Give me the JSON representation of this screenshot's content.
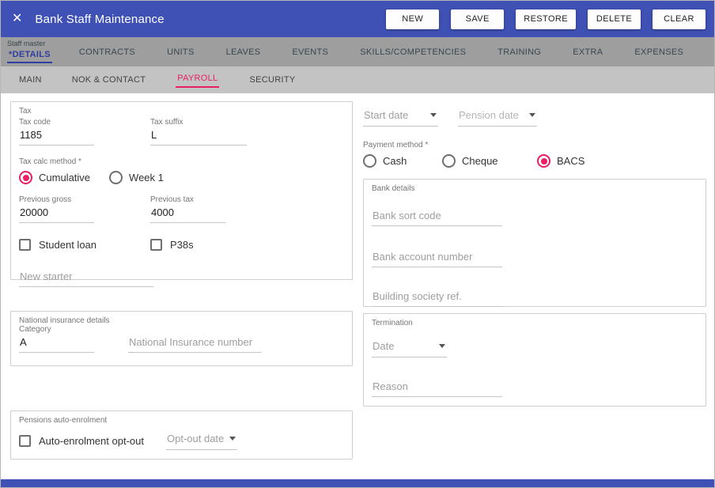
{
  "colors": {
    "header_bg": "#3f51b5",
    "accent_pink": "#e91e63",
    "active_tab_blue": "#303f9f"
  },
  "header": {
    "title": "Bank Staff Maintenance",
    "buttons": [
      "NEW",
      "SAVE",
      "RESTORE",
      "DELETE",
      "CLEAR"
    ]
  },
  "primary_tabs": {
    "group_label": "Staff master",
    "active_tab": "*DETAILS",
    "items": [
      "CONTRACTS",
      "UNITS",
      "LEAVES",
      "EVENTS",
      "SKILLS/COMPETENCIES",
      "TRAINING",
      "EXTRA",
      "EXPENSES"
    ]
  },
  "secondary_tabs": {
    "items": [
      "MAIN",
      "NOK & CONTACT",
      "PAYROLL",
      "SECURITY"
    ],
    "active": "PAYROLL"
  },
  "tax": {
    "legend": "Tax",
    "tax_code": {
      "label": "Tax code",
      "value": "1185"
    },
    "tax_suffix": {
      "label": "Tax suffix",
      "value": "L"
    },
    "tax_calc_method": {
      "label": "Tax calc method *",
      "options": [
        "Cumulative",
        "Week 1"
      ],
      "selected": "Cumulative"
    },
    "previous_gross": {
      "label": "Previous gross",
      "value": "20000"
    },
    "previous_tax": {
      "label": "Previous tax",
      "value": "4000"
    },
    "student_loan": {
      "label": "Student loan",
      "checked": false
    },
    "p38s": {
      "label": "P38s",
      "checked": false
    },
    "new_starter": {
      "placeholder": "New starter"
    }
  },
  "national_insurance": {
    "legend": "National insurance details",
    "category": {
      "label": "Category",
      "value": "A"
    },
    "ni_number": {
      "placeholder": "National Insurance number"
    }
  },
  "pensions": {
    "legend": "Pensions auto-enrolment",
    "opt_out": {
      "label": "Auto-enrolment opt-out",
      "checked": false
    },
    "opt_out_date": {
      "label": "Opt-out date"
    }
  },
  "dates": {
    "start_date": {
      "label": "Start date"
    },
    "pension_date": {
      "label": "Pension date"
    }
  },
  "payment_method": {
    "label": "Payment method *",
    "options": [
      "Cash",
      "Cheque",
      "BACS"
    ],
    "selected": "BACS"
  },
  "bank_details": {
    "legend": "Bank details",
    "sort_code": {
      "placeholder": "Bank sort code"
    },
    "account_number": {
      "placeholder": "Bank account number"
    },
    "building_society": {
      "placeholder": "Building society ref."
    }
  },
  "termination": {
    "legend": "Termination",
    "date": {
      "label": "Date"
    },
    "reason": {
      "placeholder": "Reason"
    }
  }
}
